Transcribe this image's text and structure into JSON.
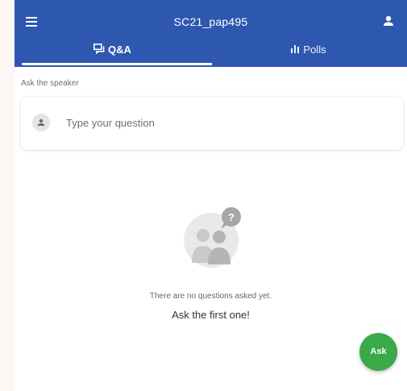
{
  "header": {
    "title": "SC21_pap495",
    "menu_icon": "hamburger-menu-icon",
    "user_icon": "account-icon",
    "background_color": "#2e57b0"
  },
  "tabs": [
    {
      "label": "Q&A",
      "icon": "chat-bubbles-icon",
      "active": true
    },
    {
      "label": "Polls",
      "icon": "bar-chart-icon",
      "active": false
    }
  ],
  "qa": {
    "ask_label": "Ask the speaker",
    "input_placeholder": "Type your question",
    "empty_message": "There are no questions asked yet.",
    "empty_cta": "Ask the first one!",
    "empty_illustration": "people-question-icon"
  },
  "fab": {
    "label": "Ask",
    "color": "#3aa948"
  }
}
